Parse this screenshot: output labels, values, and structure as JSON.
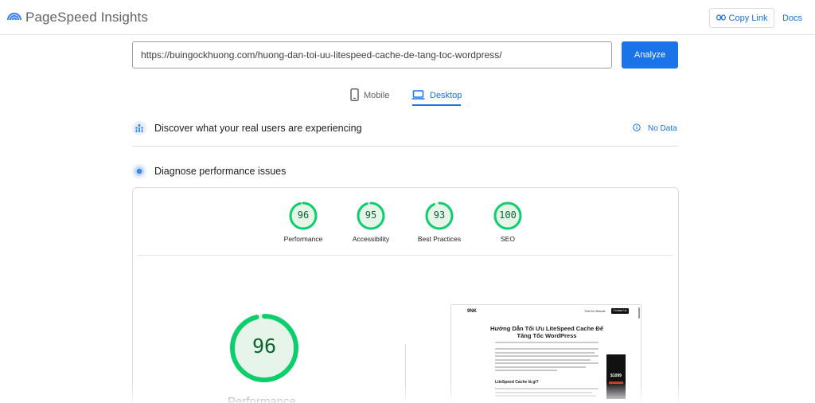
{
  "header": {
    "app_title": "PageSpeed Insights",
    "copy_link_label": "Copy Link",
    "docs_label": "Docs",
    "logo_icon": "pagespeed-logo-icon"
  },
  "search": {
    "url_value": "https://buingockhuong.com/huong-dan-toi-uu-litespeed-cache-de-tang-toc-wordpress/",
    "analyze_label": "Analyze"
  },
  "tabs": [
    {
      "label": "Mobile",
      "icon": "phone-icon",
      "active": false
    },
    {
      "label": "Desktop",
      "icon": "laptop-icon",
      "active": true
    }
  ],
  "sections": {
    "discover_title": "Discover what your real users are experiencing",
    "no_data_label": "No Data",
    "diagnose_title": "Diagnose performance issues"
  },
  "scores": [
    {
      "value": "96",
      "label": "Performance",
      "fraction": 0.96
    },
    {
      "value": "95",
      "label": "Accessibility",
      "fraction": 0.95
    },
    {
      "value": "93",
      "label": "Best Practices",
      "fraction": 0.93
    },
    {
      "value": "100",
      "label": "SEO",
      "fraction": 1.0
    }
  ],
  "main_score": {
    "value": "96",
    "label": "Performance",
    "fraction": 0.96
  },
  "preview": {
    "site_logo": "9NK",
    "nav_text": "Thiết Kế Website",
    "nav_button": "Contact Us",
    "title": "Hướng Dẫn Tối Ưu LiteSpeed Cache Để Tăng Tốc WordPress",
    "subheading": "LiteSpeed Cache là gì?",
    "ad_price": "$1099"
  },
  "colors": {
    "accent": "#1a73e8",
    "score_good": "#0cce6b",
    "score_good_text": "#0d652d"
  }
}
